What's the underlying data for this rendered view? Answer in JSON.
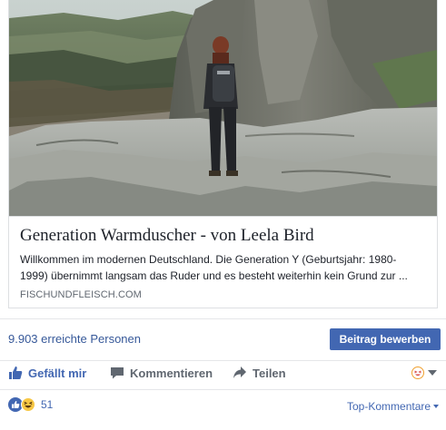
{
  "link_card": {
    "image_icon": "hiker-on-rocks-photo",
    "title": "Generation Warmduscher - von Leela Bird",
    "description": "Willkommen im modernen Deutschland. Die Generation Y (Geburtsjahr: 1980-1999) übernimmt langsam das Ruder und es besteht weiterhin kein Grund zur ...",
    "domain": "FISCHUNDFLEISCH.COM"
  },
  "stats": {
    "reach": "9.903 erreichte Personen",
    "boost_label": "Beitrag bewerben"
  },
  "actions": {
    "like": {
      "label": "Gefällt mir",
      "icon": "thumbs-up-icon"
    },
    "comment": {
      "label": "Kommentieren",
      "icon": "speech-bubble-icon"
    },
    "share": {
      "label": "Teilen",
      "icon": "share-arrow-icon"
    },
    "reaction_picker_icon": "haha-face-icon"
  },
  "reactions": {
    "icons": [
      "like-reaction-icon",
      "haha-reaction-icon"
    ],
    "count": "51",
    "sort_label": "Top-Kommentare"
  },
  "colors": {
    "link_blue": "#4267b2",
    "text_blue": "#365899",
    "gray_text": "#606770",
    "border": "#dddfe2"
  }
}
